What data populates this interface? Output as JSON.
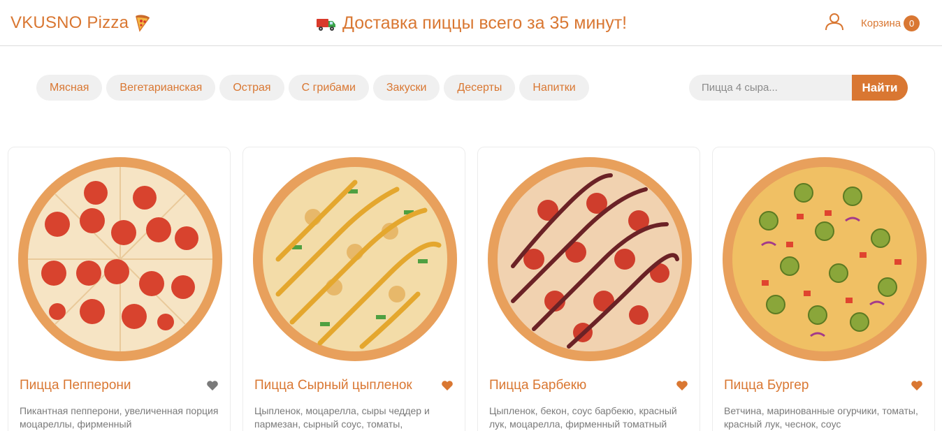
{
  "header": {
    "logo_text": "VKUSNO Pizza",
    "logo_icon": "pizza-slice-icon",
    "promo_text": "Доставка пиццы всего за 35 минут!",
    "promo_icon": "delivery-truck-icon",
    "user_icon": "user-icon",
    "cart_label": "Корзина",
    "cart_count": "0"
  },
  "categories": [
    "Мясная",
    "Вегетарианская",
    "Острая",
    "С грибами",
    "Закуски",
    "Десерты",
    "Напитки"
  ],
  "search": {
    "placeholder": "Пицца 4 сыра...",
    "button_label": "Найти"
  },
  "colors": {
    "accent": "#d97732",
    "pill_bg": "#f0f0f0",
    "heart_inactive": "#7a7a7a",
    "heart_active": "#d97732"
  },
  "products": [
    {
      "title": "Пицца Пепперони",
      "description": "Пикантная пепперони, увеличенная порция моцареллы, фирменный",
      "favorite": false,
      "image": "pepperoni-pizza-image"
    },
    {
      "title": "Пицца Сырный цыпленок",
      "description": "Цыпленок, моцарелла, сыры чеддер и пармезан, сырный соус, томаты,",
      "favorite": true,
      "image": "cheese-chicken-pizza-image"
    },
    {
      "title": "Пицца Барбекю",
      "description": "Цыпленок, бекон, соус барбекю, красный лук, моцарелла, фирменный томатный",
      "favorite": true,
      "image": "bbq-pizza-image"
    },
    {
      "title": "Пицца Бургер",
      "description": "Ветчина, маринованные огурчики, томаты, красный лук, чеснок, соус",
      "favorite": true,
      "image": "burger-pizza-image"
    }
  ]
}
